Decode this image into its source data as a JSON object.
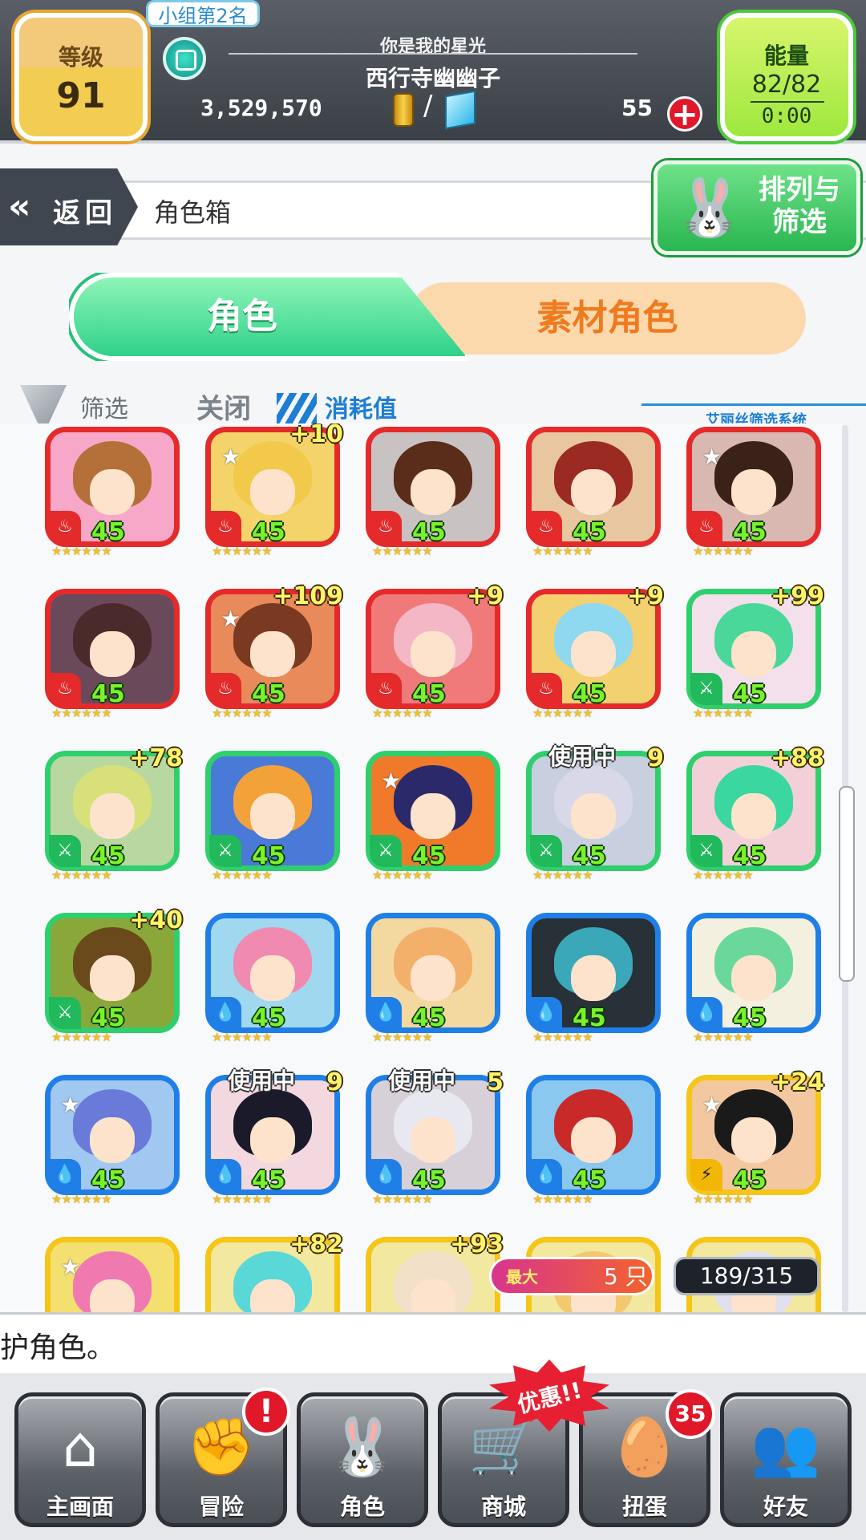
{
  "header": {
    "level_label": "等级",
    "level_value": "91",
    "rank_tag": "小组第2名",
    "player_subtitle": "你是我的星光",
    "player_name": "西行寺幽幽子",
    "coins": "3,529,570",
    "slash": "/",
    "gems": "55",
    "add_symbol": "+",
    "energy_label": "能量",
    "energy_value": "82/82",
    "energy_timer": "0:00"
  },
  "titlebar": {
    "back_chevron": "«",
    "back_label": "返回",
    "title": "角色箱",
    "sort_label": "排列与筛选",
    "sort_icon": "rabbit-icon"
  },
  "tabs": {
    "characters": "角色",
    "materials": "素材角色"
  },
  "filter": {
    "filter_label": "筛选",
    "off_label": "关闭",
    "cost_label": "消耗值",
    "system_label": "艾丽丝筛选系统"
  },
  "cards": [
    {
      "element": "fire",
      "level": "45",
      "plus": "",
      "star": false,
      "in_use": false,
      "hair": "#b5703a",
      "sky": "#f7a8c8"
    },
    {
      "element": "fire",
      "level": "45",
      "plus": "+10",
      "star": true,
      "in_use": false,
      "hair": "#f2c94a",
      "sky": "#f4d46a"
    },
    {
      "element": "fire",
      "level": "45",
      "plus": "",
      "star": false,
      "in_use": false,
      "hair": "#5a2c1a",
      "sky": "#c9c2c2"
    },
    {
      "element": "fire",
      "level": "45",
      "plus": "",
      "star": false,
      "in_use": false,
      "hair": "#9a2a22",
      "sky": "#e8c6a0"
    },
    {
      "element": "fire",
      "level": "45",
      "plus": "",
      "star": true,
      "in_use": false,
      "hair": "#3a2218",
      "sky": "#d8b8b0"
    },
    {
      "element": "fire",
      "level": "45",
      "plus": "",
      "star": false,
      "in_use": false,
      "hair": "#4a2a2a",
      "sky": "#6a4a5a"
    },
    {
      "element": "fire",
      "level": "45",
      "plus": "+109",
      "star": true,
      "in_use": false,
      "hair": "#7a3a22",
      "sky": "#e88a5a"
    },
    {
      "element": "fire",
      "level": "45",
      "plus": "+9",
      "star": false,
      "in_use": false,
      "hair": "#f3b7c6",
      "sky": "#f07a7a"
    },
    {
      "element": "fire",
      "level": "45",
      "plus": "+9",
      "star": false,
      "in_use": false,
      "hair": "#8ed8f0",
      "sky": "#f3d070"
    },
    {
      "element": "wood",
      "level": "45",
      "plus": "+99",
      "star": false,
      "in_use": false,
      "hair": "#4ad89a",
      "sky": "#f3e0ea"
    },
    {
      "element": "wood",
      "level": "45",
      "plus": "+78",
      "star": false,
      "in_use": false,
      "hair": "#d8e07a",
      "sky": "#b8d8a0"
    },
    {
      "element": "wood",
      "level": "45",
      "plus": "",
      "star": false,
      "in_use": false,
      "hair": "#f3a23a",
      "sky": "#4a7ad8"
    },
    {
      "element": "wood",
      "level": "45",
      "plus": "",
      "star": true,
      "in_use": false,
      "hair": "#2a2a6a",
      "sky": "#f07a2a"
    },
    {
      "element": "wood",
      "level": "45",
      "plus": "9",
      "star": false,
      "in_use": true,
      "hair": "#d8d8e8",
      "sky": "#c8d0e0"
    },
    {
      "element": "wood",
      "level": "45",
      "plus": "+88",
      "star": false,
      "in_use": false,
      "hair": "#3ad8a0",
      "sky": "#f3d0d8"
    },
    {
      "element": "wood",
      "level": "45",
      "plus": "+40",
      "star": false,
      "in_use": false,
      "hair": "#6a4a1a",
      "sky": "#8aa83a"
    },
    {
      "element": "water",
      "level": "45",
      "plus": "",
      "star": false,
      "in_use": false,
      "hair": "#f08ab0",
      "sky": "#a0d8f0"
    },
    {
      "element": "water",
      "level": "45",
      "plus": "",
      "star": false,
      "in_use": false,
      "hair": "#f3b06a",
      "sky": "#f3d8a0"
    },
    {
      "element": "water",
      "level": "45",
      "plus": "",
      "star": false,
      "in_use": false,
      "hair": "#3aa8b8",
      "sky": "#283038"
    },
    {
      "element": "water",
      "level": "45",
      "plus": "",
      "star": false,
      "in_use": false,
      "hair": "#6ad89a",
      "sky": "#f3f0e0"
    },
    {
      "element": "water",
      "level": "45",
      "plus": "",
      "star": true,
      "in_use": false,
      "hair": "#6a7ad8",
      "sky": "#a0c8f0"
    },
    {
      "element": "water",
      "level": "45",
      "plus": "9",
      "star": false,
      "in_use": true,
      "hair": "#1a1a2a",
      "sky": "#f3d8e0"
    },
    {
      "element": "water",
      "level": "45",
      "plus": "5",
      "star": false,
      "in_use": true,
      "hair": "#e8e8f0",
      "sky": "#d8d0d8"
    },
    {
      "element": "water",
      "level": "45",
      "plus": "",
      "star": false,
      "in_use": false,
      "hair": "#c82a2a",
      "sky": "#8ac8f0"
    },
    {
      "element": "light",
      "level": "45",
      "plus": "+24",
      "star": true,
      "in_use": false,
      "hair": "#1a1a1a",
      "sky": "#f3c8a0"
    },
    {
      "element": "light",
      "level": "",
      "plus": "",
      "star": true,
      "in_use": false,
      "hair": "#f07ab0",
      "sky": "#f3e070"
    },
    {
      "element": "light",
      "level": "",
      "plus": "+82",
      "star": false,
      "in_use": false,
      "hair": "#5ad8d8",
      "sky": "#f3e8a0"
    },
    {
      "element": "light",
      "level": "",
      "plus": "+93",
      "star": false,
      "in_use": false,
      "hair": "#f3e0c8",
      "sky": "#f3e8a0"
    },
    {
      "element": "light",
      "level": "",
      "plus": "",
      "star": false,
      "in_use": false,
      "hair": "#f3c870",
      "sky": "#f3e8a0"
    },
    {
      "element": "light",
      "level": "",
      "plus": "",
      "star": false,
      "in_use": false,
      "hair": "#e0e0f0",
      "sky": "#f3e8a0"
    }
  ],
  "card_text": {
    "in_use_label": "使用中",
    "stars": "★★★★★★",
    "star_badge": "★"
  },
  "element_icons": {
    "fire": "♨",
    "wood": "⚔",
    "water": "💧",
    "light": "⚡"
  },
  "counters": {
    "max_label": "最大",
    "max_value": "5 只",
    "box_count": "189/315"
  },
  "info_text": "护角色。",
  "nav": {
    "home": "主画面",
    "adventure": "冒险",
    "characters": "角色",
    "shop": "商城",
    "gacha": "扭蛋",
    "friends": "好友",
    "adventure_alert": "!",
    "sale_label": "优惠!!",
    "gacha_count": "35"
  },
  "colors": {
    "fire": "#e42a2a",
    "wood": "#2fcf6d",
    "water": "#1f7fe6",
    "light": "#f5c518"
  }
}
